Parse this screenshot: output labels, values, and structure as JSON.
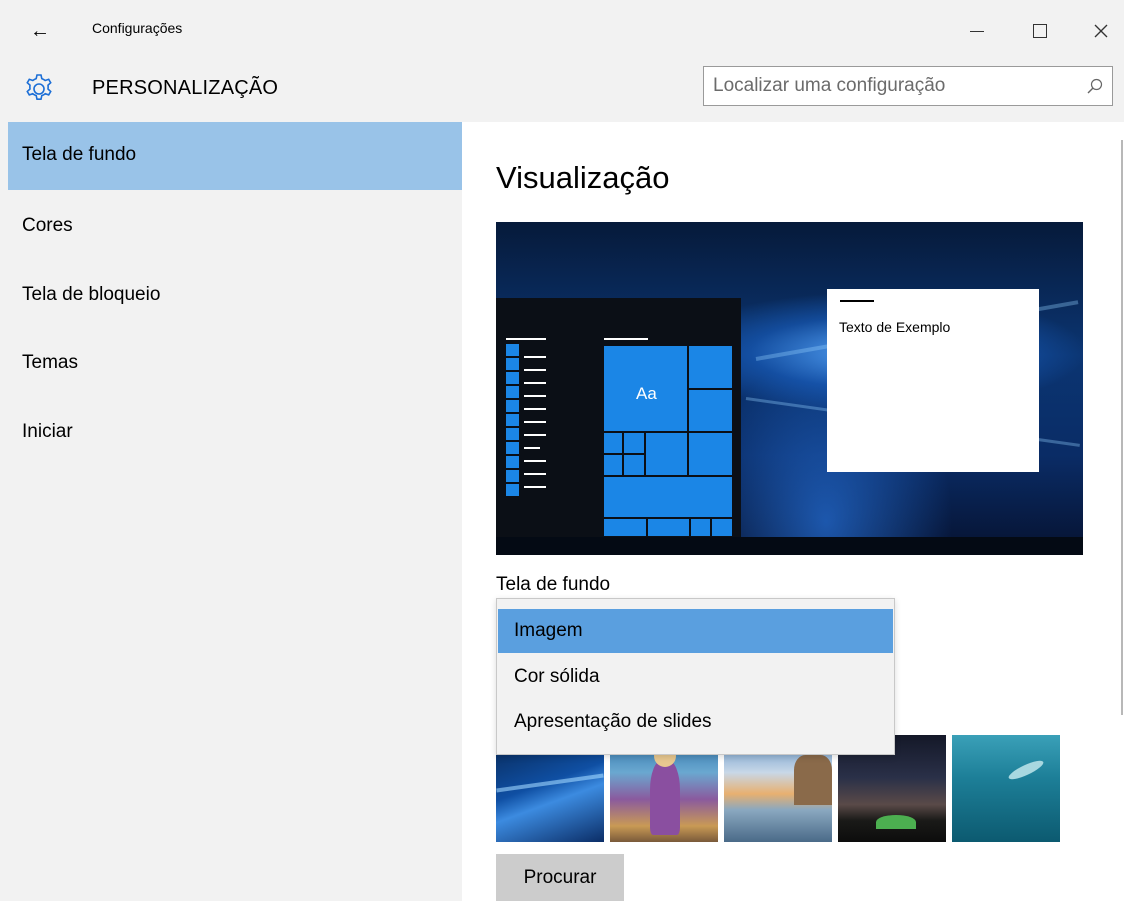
{
  "window": {
    "title": "Configurações",
    "back_icon": "arrow-left-icon"
  },
  "header": {
    "section_title": "PERSONALIZAÇÃO",
    "search_placeholder": "Localizar uma configuração"
  },
  "sidebar": {
    "items": [
      {
        "label": "Tela de fundo",
        "active": true
      },
      {
        "label": "Cores",
        "active": false
      },
      {
        "label": "Tela de bloqueio",
        "active": false
      },
      {
        "label": "Temas",
        "active": false
      },
      {
        "label": "Iniciar",
        "active": false
      }
    ]
  },
  "main": {
    "preview_heading": "Visualização",
    "preview": {
      "tile_text": "Aa",
      "sample_text": "Texto de Exemplo"
    },
    "background_label": "Tela de fundo",
    "dropdown_options": [
      "Imagem",
      "Cor sólida",
      "Apresentação de slides"
    ],
    "selected_option": "Imagem",
    "browse_label": "Procurar"
  },
  "colors": {
    "accent": "#1b86e6",
    "nav_active": "#99c3e8",
    "dropdown_selected": "#5a9fdf"
  }
}
